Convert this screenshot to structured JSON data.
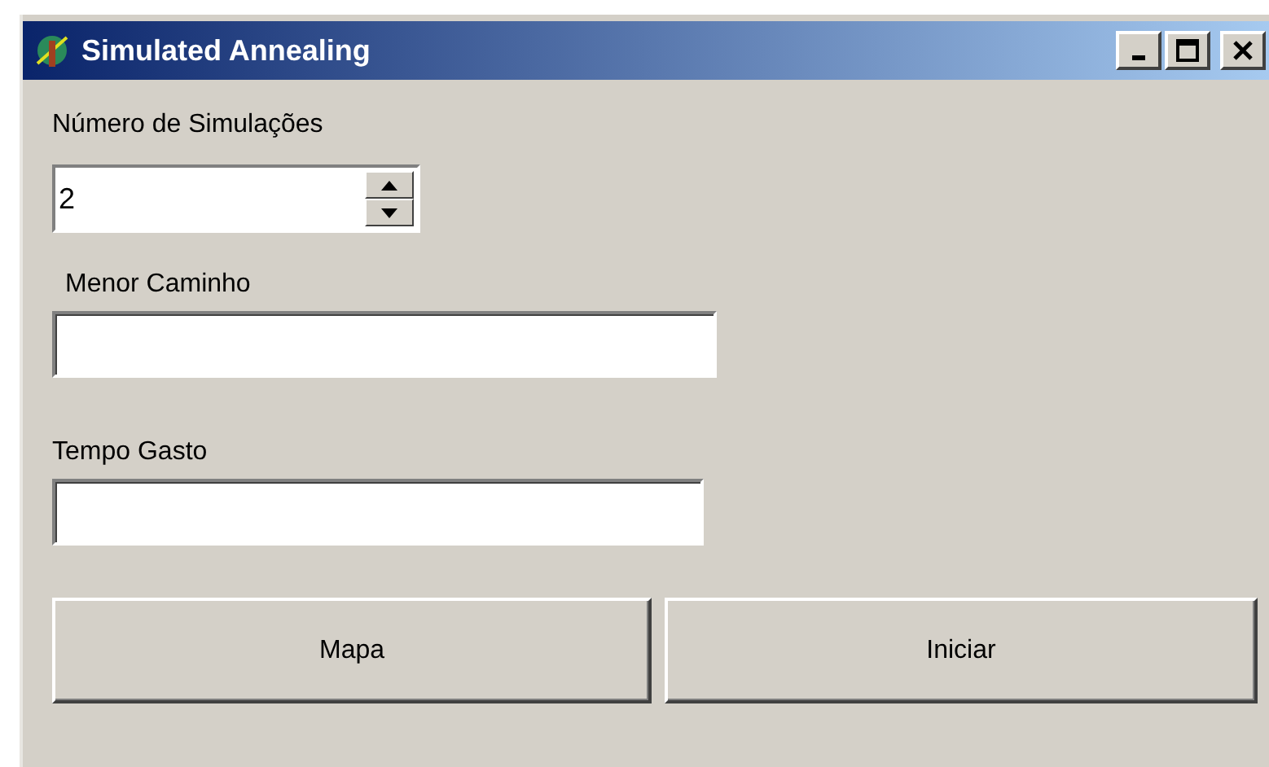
{
  "window": {
    "title": "Simulated Annealing"
  },
  "simulations": {
    "label": "Número de Simulações",
    "value": "2"
  },
  "shortest_path": {
    "label": "Menor Caminho"
  },
  "time_spent": {
    "label": "Tempo Gasto"
  },
  "buttons": [
    {
      "label": "Mapa"
    },
    {
      "label": "Iniciar"
    }
  ]
}
